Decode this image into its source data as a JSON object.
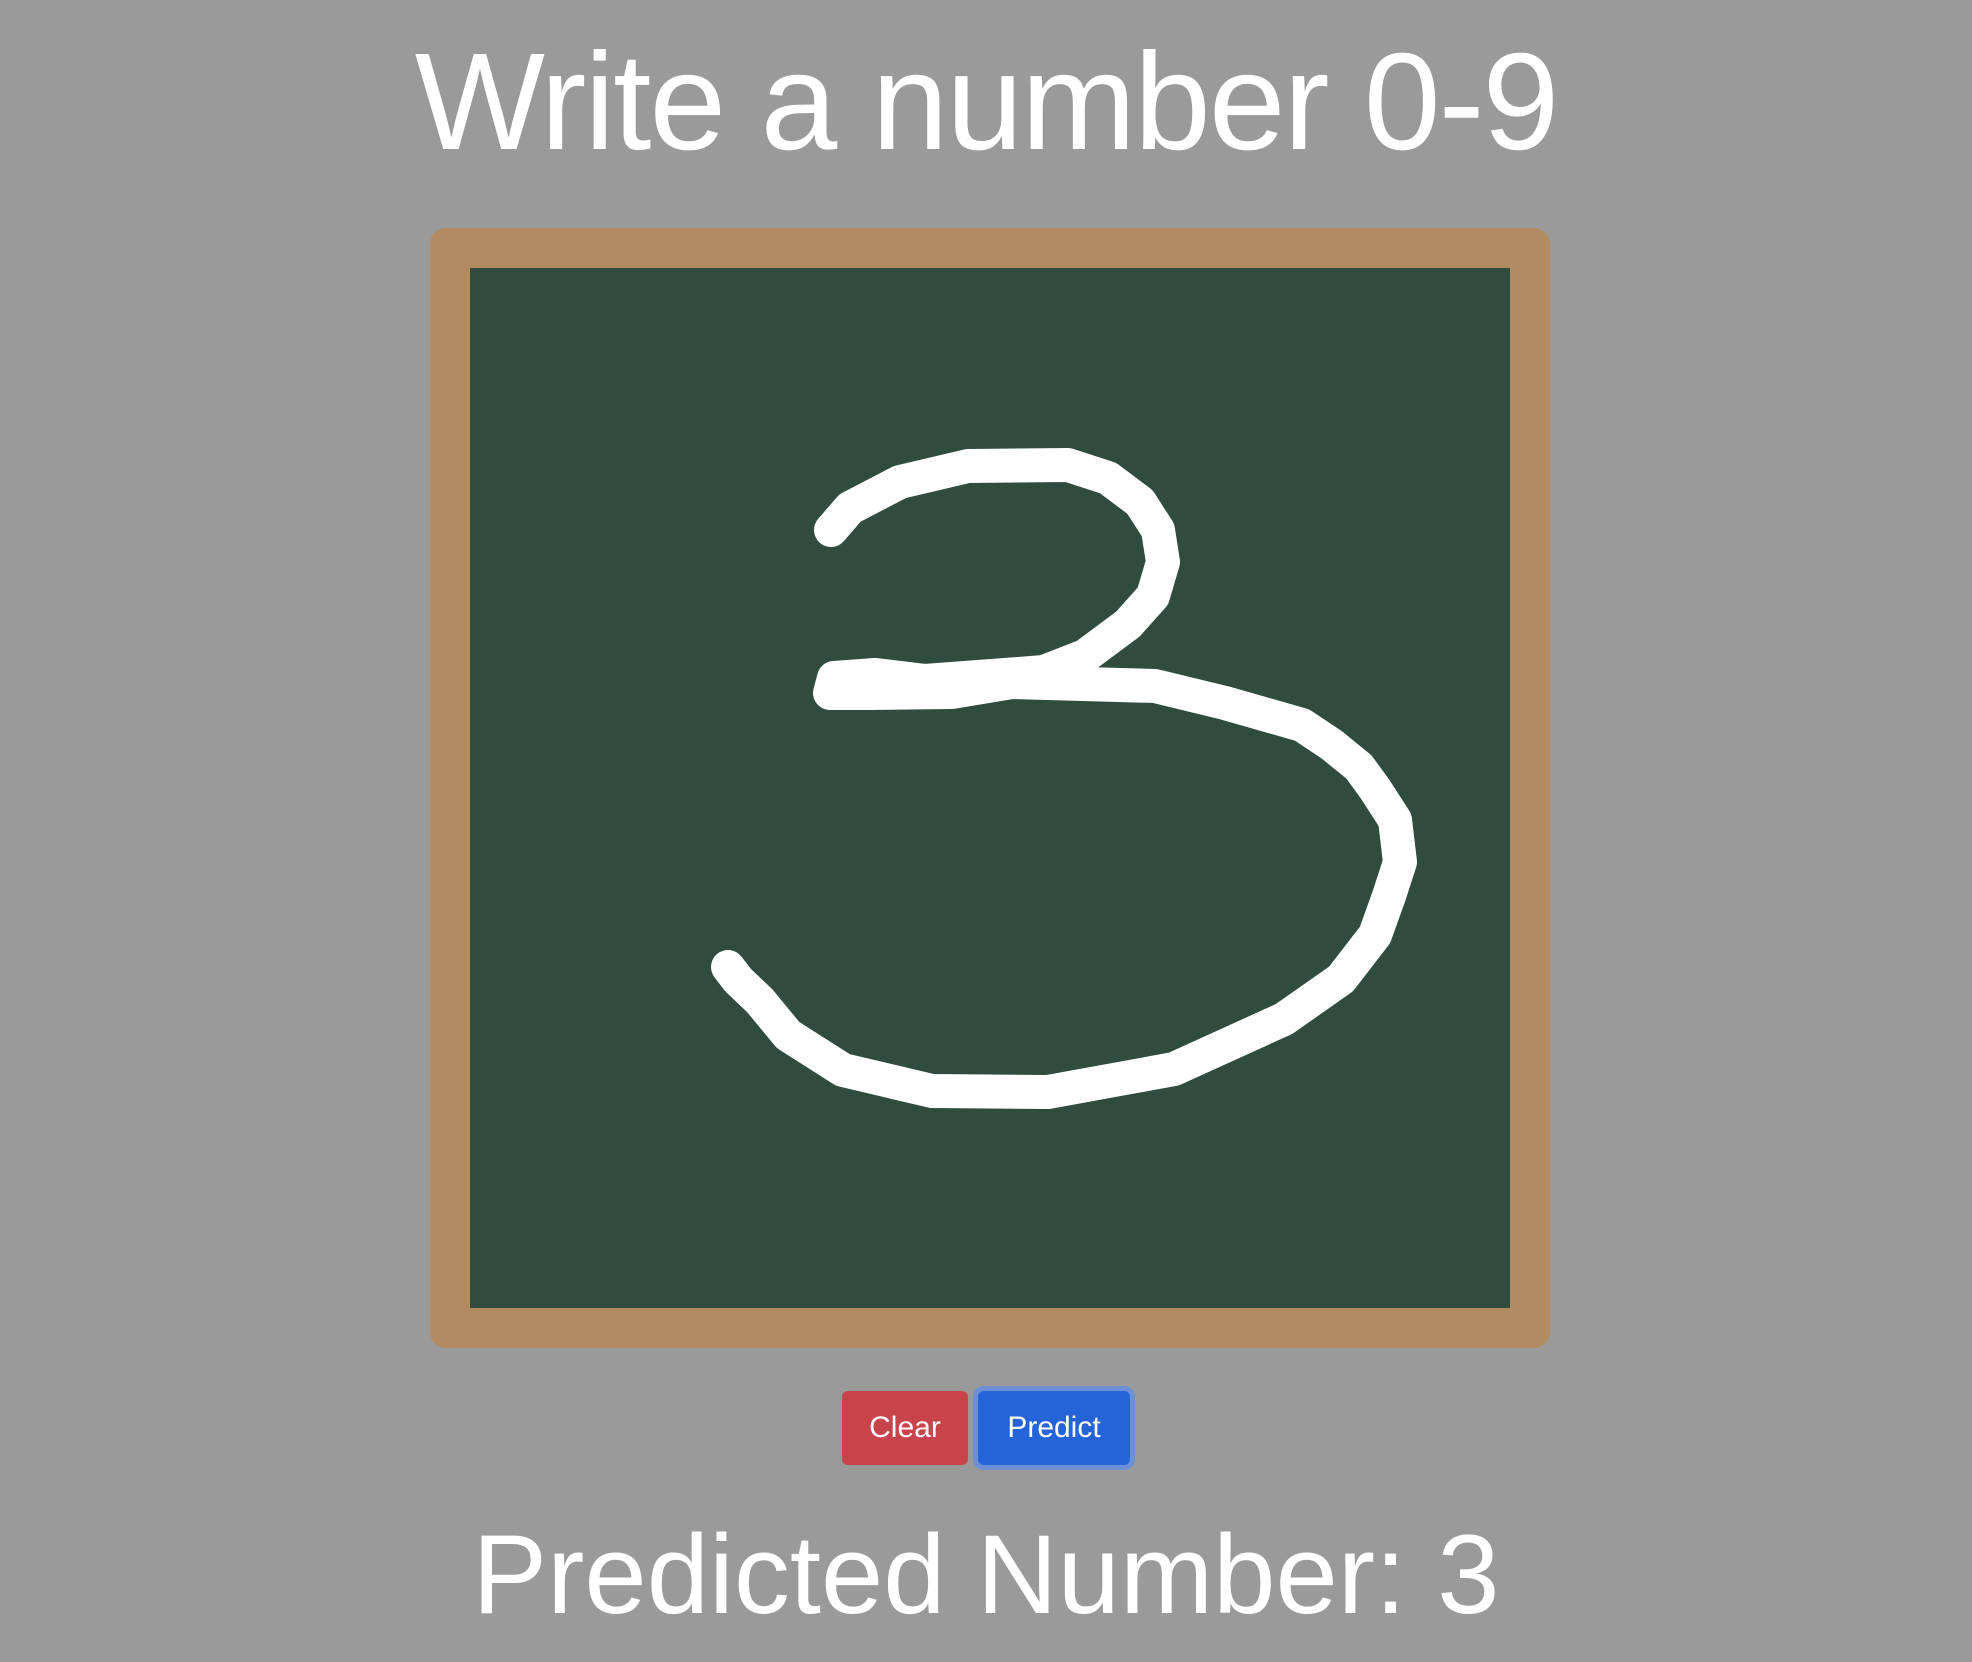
{
  "header": {
    "title": "Write a number 0-9"
  },
  "canvas": {
    "board_color": "#2f4c3e",
    "frame_color": "#b38b61",
    "stroke_color": "#ffffff",
    "drawn_digit_icon": "handwritten-3"
  },
  "actions": {
    "clear_label": "Clear",
    "predict_label": "Predict",
    "clear_color": "#c9434a",
    "predict_color": "#2563d9"
  },
  "result": {
    "label": "Predicted Number: 3"
  }
}
